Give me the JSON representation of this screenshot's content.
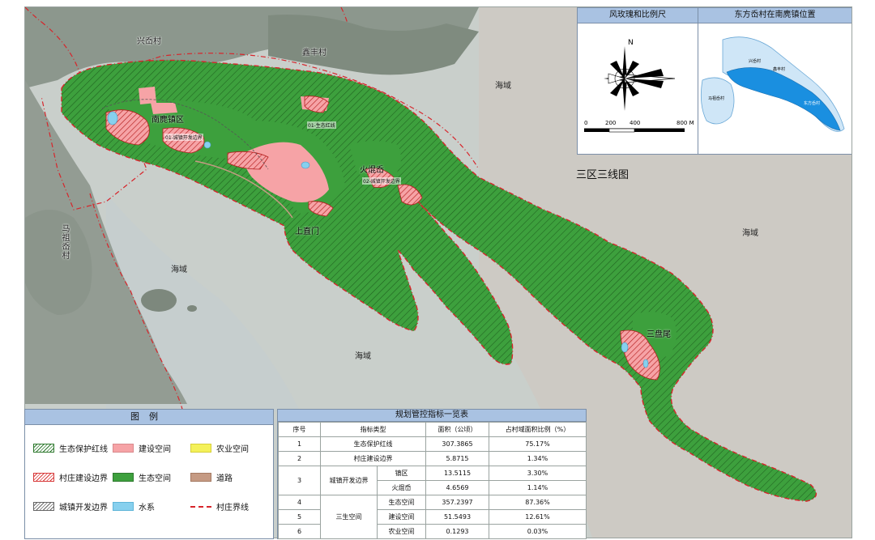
{
  "labels": {
    "xingdang": "兴岙村",
    "xinfeng": "鑫丰村",
    "mazu": "马祖岙村",
    "nanlu_town": "南麂镇区",
    "huoyao": "火焜岙",
    "sanpan": "三盘尾",
    "shangzhimen": "上直门",
    "sea_north": "海域",
    "sea_east": "海域",
    "sea_west": "海域",
    "sea_south": "海域",
    "map_title": "三区三线图",
    "boundary_1": "01-城镇开发边界",
    "boundary_2": "01-生态红线",
    "boundary_3": "02-城镇开发边界"
  },
  "compass_panel": {
    "title": "风玫瑰和比例尺",
    "north": "N",
    "scale_ticks": [
      "0",
      "200",
      "400",
      "800 M"
    ]
  },
  "location_panel": {
    "title": "东方岙村在南麂镇位置",
    "labels": [
      "兴岙村",
      "鑫丰村",
      "马祖岙村",
      "东方岙村"
    ]
  },
  "legend": {
    "title": "图例",
    "items": [
      {
        "label": "生态保护红线",
        "swatch": "eco-redline"
      },
      {
        "label": "建设空间",
        "swatch": "construction"
      },
      {
        "label": "农业空间",
        "swatch": "agriculture"
      },
      {
        "label": "村庄建设边界",
        "swatch": "village-boundary"
      },
      {
        "label": "生态空间",
        "swatch": "ecological"
      },
      {
        "label": "道路",
        "swatch": "road"
      },
      {
        "label": "城镇开发边界",
        "swatch": "town-boundary"
      },
      {
        "label": "水系",
        "swatch": "water"
      },
      {
        "label": "村庄界线",
        "swatch": "village-line"
      }
    ]
  },
  "indicator_table": {
    "title": "规划管控指标一览表",
    "headers": [
      "序号",
      "指标类型",
      "面积（公顷）",
      "占村域面积比例（%）"
    ],
    "rows": {
      "r1": {
        "no": "1",
        "type": "生态保护红线",
        "area": "307.3865",
        "ratio": "75.17%"
      },
      "r2": {
        "no": "2",
        "type": "村庄建设边界",
        "area": "5.8715",
        "ratio": "1.34%"
      },
      "r3": {
        "no": "3",
        "type": "城镇开发边界",
        "sub1": "镇区",
        "area1": "13.5115",
        "ratio1": "3.30%",
        "sub2": "火焜岙",
        "area2": "4.6569",
        "ratio2": "1.14%"
      },
      "r4": {
        "no": "4",
        "sub": "生态空间",
        "area": "357.2397",
        "ratio": "87.36%"
      },
      "r5": {
        "no": "5",
        "type": "三生空间",
        "sub": "建设空间",
        "area": "51.5493",
        "ratio": "12.61%"
      },
      "r6": {
        "no": "6",
        "sub": "农业空间",
        "area": "0.1293",
        "ratio": "0.03%"
      }
    }
  },
  "colors": {
    "eco_green": "#3da03d",
    "hatch": "#2f7a2f",
    "construction": "#f6a3a6",
    "village_red": "#d83a3a",
    "water": "#87d0ee",
    "boundary_red": "#d7252b",
    "header_blue": "#a9c2e2",
    "sea": "#c7cec9"
  }
}
